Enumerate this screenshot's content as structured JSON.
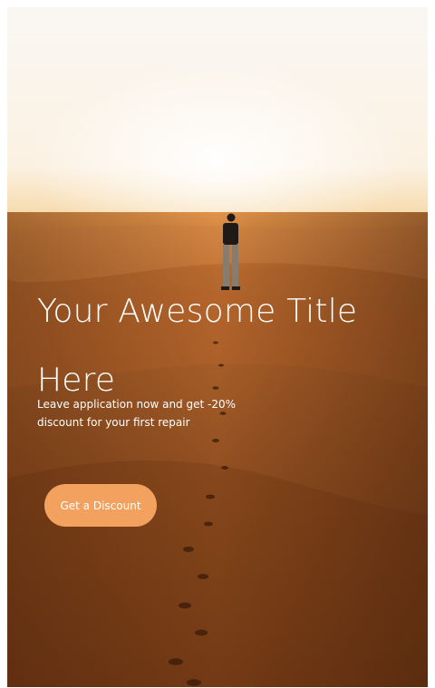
{
  "hero": {
    "title": "Your Awesome Title Here",
    "subtitle": "Leave application now and get -20% discount for your first repair",
    "cta_label": "Get a Discount",
    "background_image": "desert-dunes-sunset-photo"
  },
  "colors": {
    "cta_background": "#f2a15f",
    "text": "#ffffff",
    "sky": "#fbf6ef",
    "sand_dark": "#7a3f16"
  }
}
